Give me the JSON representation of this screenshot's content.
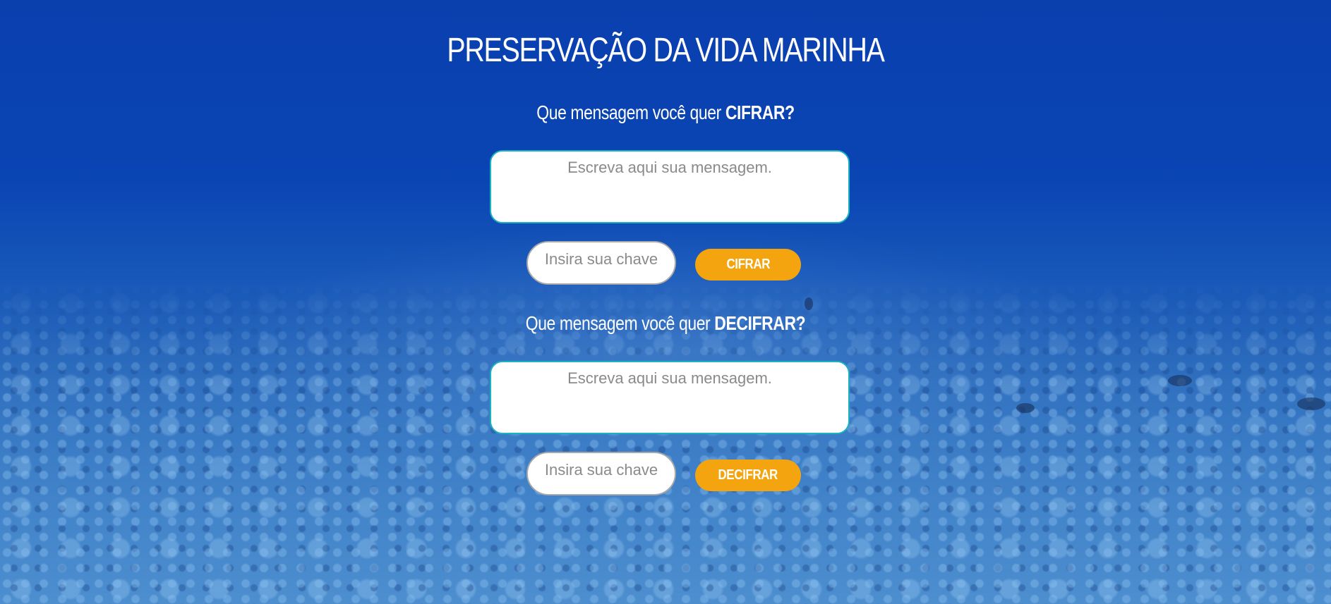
{
  "page": {
    "title": "PRESERVAÇÃO DA VIDA MARINHA"
  },
  "encrypt": {
    "question_prefix": "Que mensagem você quer ",
    "question_emphasis": "CIFRAR?",
    "message_placeholder": "Escreva aqui sua mensagem.",
    "message_value": "",
    "key_placeholder": "Insira sua chave",
    "key_value": "",
    "button_label": "CIFRAR"
  },
  "decrypt": {
    "question_prefix": "Que mensagem você quer ",
    "question_emphasis": "DECIFRAR?",
    "message_placeholder": "Escreva aqui sua mensagem.",
    "message_value": "",
    "key_placeholder": "Insira sua chave",
    "key_value": "",
    "button_label": "DECIFRAR"
  },
  "colors": {
    "background_top": "#0a3fae",
    "background_bottom": "#4a8bcc",
    "button": "#f3a40e",
    "textarea_border": "#1bb2c0",
    "key_border": "#a9a9a9",
    "text": "#ffffff",
    "placeholder": "#8a8a8a"
  }
}
